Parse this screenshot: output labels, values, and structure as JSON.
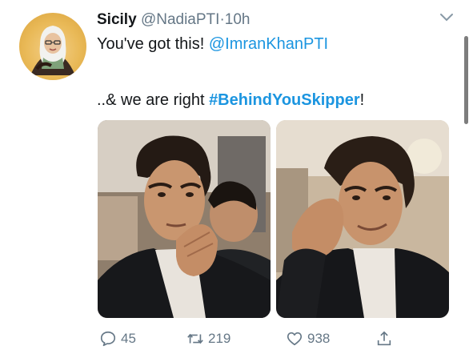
{
  "tweet": {
    "author_name": "Sicily",
    "handle": "@NadiaPTI",
    "separator": "·",
    "timestamp": "10h",
    "line1_text": "You've got this! ",
    "line1_mention": "@ImranKhanPTI",
    "line2_prefix": "..& we are right ",
    "line2_hashtag": "#BehindYouSkipper",
    "line2_suffix": "!"
  },
  "actions": {
    "reply_count": "45",
    "retweet_count": "219",
    "like_count": "938"
  },
  "icons": {
    "menu": "chevron-down-icon",
    "reply": "comment-bubble-icon",
    "retweet": "retweet-arrows-icon",
    "like": "heart-icon",
    "share": "share-up-arrow-icon"
  },
  "colors": {
    "link": "#1b95e0",
    "muted": "#657786",
    "text": "#14171a"
  }
}
